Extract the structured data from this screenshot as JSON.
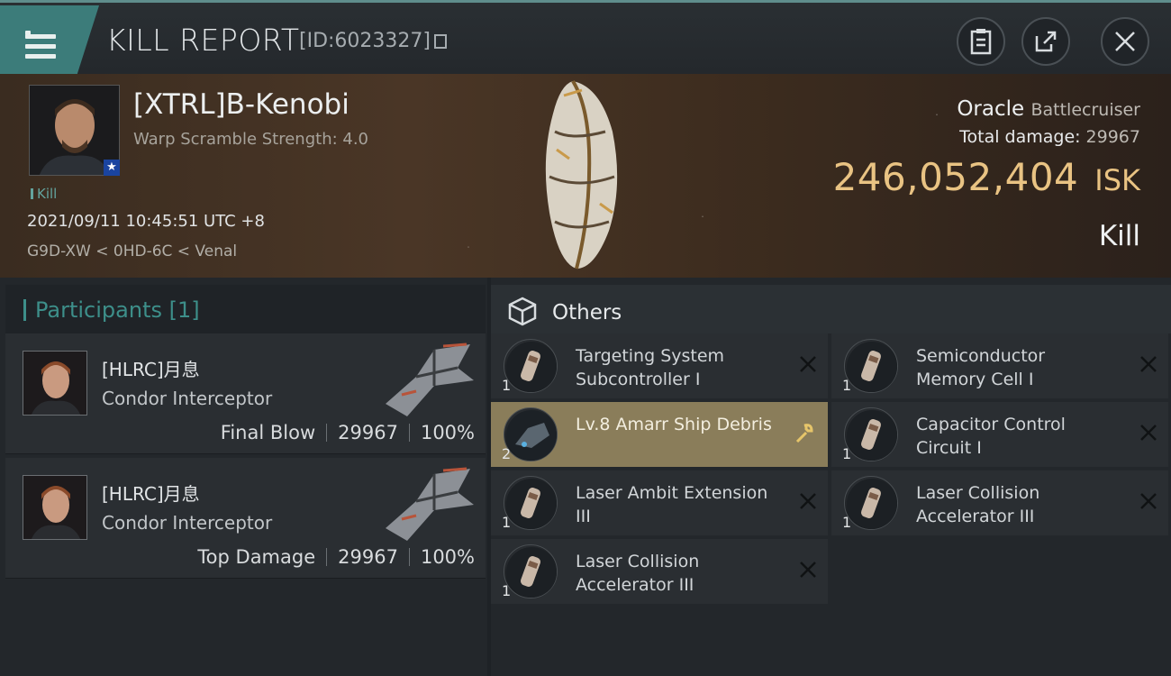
{
  "header": {
    "title": "KILL REPORT",
    "report_id": "[ID:6023327]",
    "icons": [
      "menu-icon",
      "clipboard-icon",
      "share-icon",
      "close-icon"
    ]
  },
  "victim": {
    "name": "[XTRL]B-Kenobi",
    "warp_scramble": "Warp Scramble Strength: 4.0",
    "kill_tag": "Kill",
    "datetime": "2021/09/11 10:45:51 UTC +8",
    "location": "G9D-XW < 0HD-6C < Venal",
    "ship_name": "Oracle",
    "ship_class": "Battlecruiser",
    "total_damage_label": "Total damage:",
    "total_damage_value": "29967",
    "isk_value": "246,052,404",
    "isk_unit": "ISK",
    "result": "Kill"
  },
  "participants": {
    "title": "Participants [1]",
    "rows": [
      {
        "name": "[HLRC]月息",
        "ship": "Condor Interceptor",
        "role": "Final Blow",
        "damage": "29967",
        "percent": "100%"
      },
      {
        "name": "[HLRC]月息",
        "ship": "Condor Interceptor",
        "role": "Top Damage",
        "damage": "29967",
        "percent": "100%"
      }
    ]
  },
  "others": {
    "title": "Others",
    "items": [
      {
        "label": "Targeting System Subcontroller I",
        "qty": "1",
        "icon": "rig-icon",
        "highlight": false
      },
      {
        "label": "Semiconductor Memory Cell I",
        "qty": "1",
        "icon": "rig-icon",
        "highlight": false
      },
      {
        "label": "Lv.8 Amarr Ship Debris",
        "qty": "2",
        "icon": "debris-icon",
        "highlight": true
      },
      {
        "label": "Capacitor Control Circuit I",
        "qty": "1",
        "icon": "rig-icon",
        "highlight": false
      },
      {
        "label": "Laser Ambit Extension III",
        "qty": "1",
        "icon": "rig-icon",
        "highlight": false
      },
      {
        "label": "Laser Collision Accelerator III",
        "qty": "1",
        "icon": "rig-icon",
        "highlight": false
      },
      {
        "label": "Laser Collision Accelerator III",
        "qty": "1",
        "icon": "rig-icon",
        "highlight": false
      }
    ]
  },
  "colors": {
    "accent": "#3c7c7a",
    "isk_gold": "#e9c383",
    "highlight_row": "#8a7d5a"
  }
}
